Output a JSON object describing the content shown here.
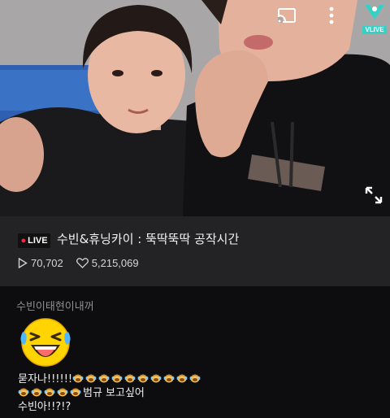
{
  "video": {
    "cast_icon": "cast-icon",
    "more_icon": "more-vertical-icon",
    "logo_text": "VLIVE",
    "fullscreen_icon": "fullscreen-icon"
  },
  "info": {
    "live_label": "LIVE",
    "title": "수빈&휴닝카이 : 뚝딱뚝딱 공작시간",
    "plays": "70,702",
    "hearts": "5,215,069",
    "play_icon": "play-icon",
    "heart_icon": "heart-icon"
  },
  "comment": {
    "username": "수빈이태현이내꺼",
    "sticker_icon": "laughing-face-sticker",
    "line1_text": "묻자나!!!!!!",
    "line2_text": "범규 보고싶어",
    "line3_text": "수빈아!!?!?",
    "emoji_icon": "crying-face-emoji"
  },
  "colors": {
    "background": "#0d0d0f",
    "info_bar": "#232326",
    "live_dot": "#ff2442",
    "logo": "#36d1c4"
  }
}
